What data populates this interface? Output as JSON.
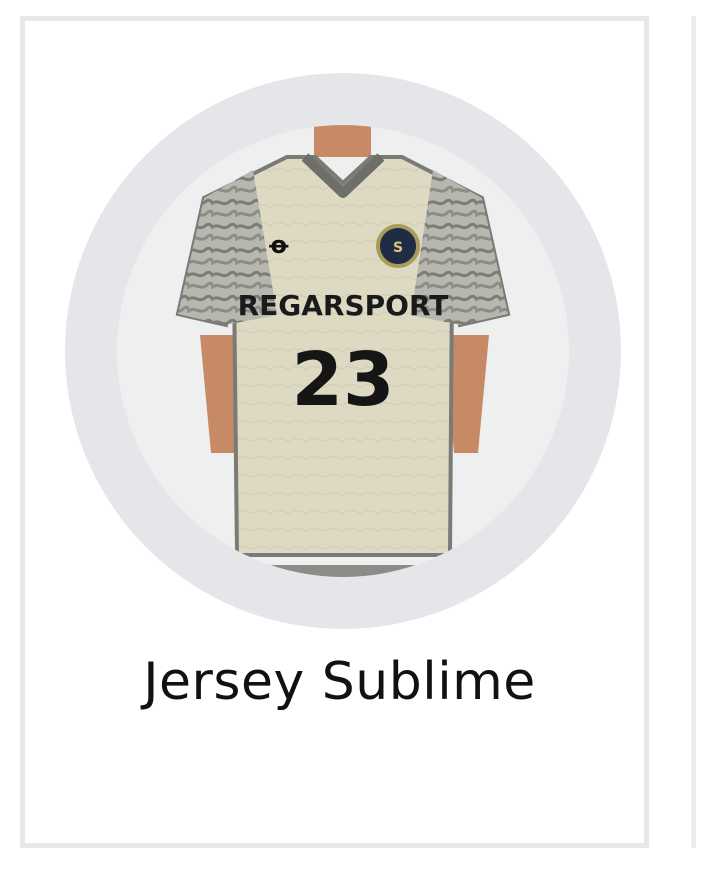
{
  "product": {
    "title": "Jersey Sublime",
    "image": {
      "brand_text": "REGARSPORT",
      "number": "23"
    }
  },
  "colors": {
    "card_border": "#e8e8ea",
    "ring": "#e5e6ea",
    "inner": "#eef0f0",
    "jersey": "#ddd9c3",
    "trim": "#6e6e6a",
    "skin": "#c68a67",
    "text": "#111111"
  }
}
